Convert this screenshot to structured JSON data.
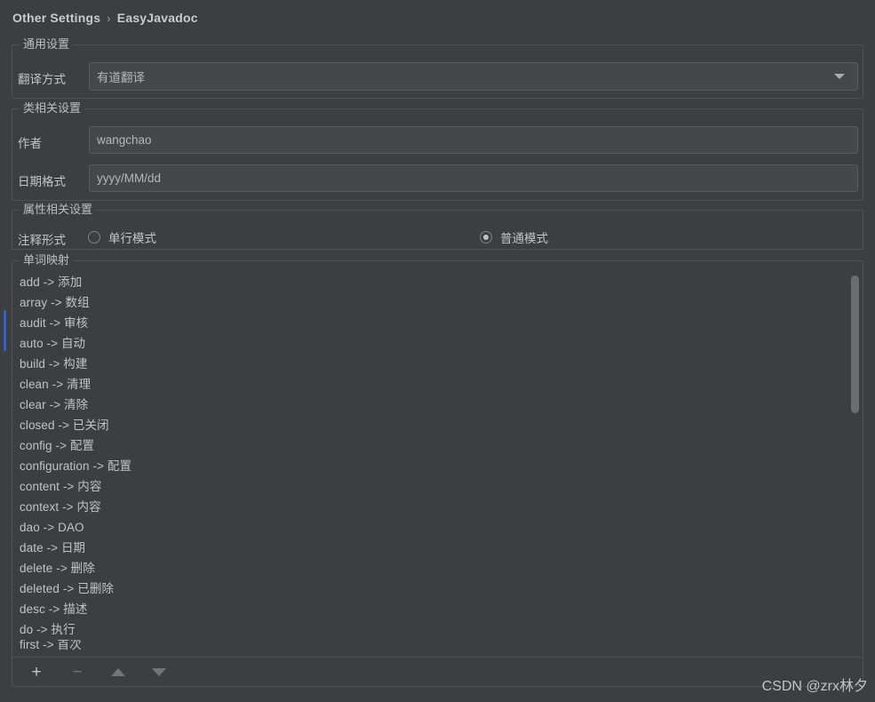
{
  "window": {
    "background_color": "#3c3f41",
    "text_color": "#bbbbbb"
  },
  "breadcrumb": {
    "root": "Other Settings",
    "separator": "›",
    "current": "EasyJavadoc"
  },
  "groups": {
    "general": {
      "title": "通用设置",
      "translate_method_label": "翻译方式",
      "translate_method_value": "有道翻译",
      "dropdown_icon": "chevron-down-icon"
    },
    "class": {
      "title": "类相关设置",
      "author_label": "作者",
      "author_value": "wangchao",
      "date_format_label": "日期格式",
      "date_format_value": "yyyy/MM/dd"
    },
    "attribute": {
      "title": "属性相关设置",
      "comment_form_label": "注释形式",
      "options": [
        {
          "label": "单行模式",
          "checked": false
        },
        {
          "label": "普通模式",
          "checked": true
        }
      ]
    },
    "words": {
      "title": "单词映射",
      "entries": [
        "add -> 添加",
        "array -> 数组",
        "audit -> 审核",
        "auto -> 自动",
        "build -> 构建",
        "clean -> 清理",
        "clear -> 清除",
        "closed -> 已关闭",
        "config -> 配置",
        "configuration -> 配置",
        "content -> 内容",
        "context -> 内容",
        "dao -> DAO",
        "date -> 日期",
        "delete -> 删除",
        "deleted -> 已删除",
        "desc -> 描述",
        "do -> 执行"
      ],
      "partial_entry": "first -> 首次",
      "toolbar": {
        "add": {
          "icon": "plus-icon",
          "glyph": "+",
          "enabled": true
        },
        "remove": {
          "icon": "minus-icon",
          "glyph": "−",
          "enabled": false
        },
        "move_up": {
          "icon": "arrow-up-icon",
          "enabled": false
        },
        "move_down": {
          "icon": "arrow-down-icon",
          "enabled": false
        }
      }
    }
  },
  "selection": {
    "accent_color": "#2d63c8"
  },
  "scrollbar": {
    "thumb_color": "#6a6e70"
  },
  "watermark": {
    "text": "CSDN @zrx林夕"
  }
}
